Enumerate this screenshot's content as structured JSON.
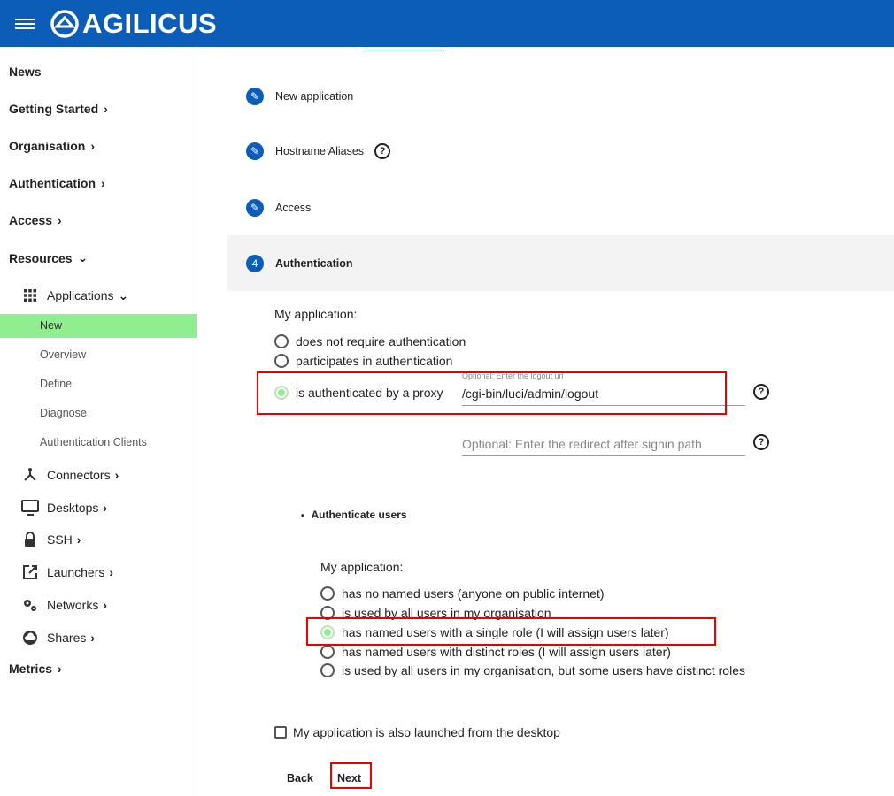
{
  "header": {
    "brand": "AGILICUS"
  },
  "sidebar": {
    "news": "News",
    "getting_started": "Getting Started",
    "organisation": "Organisation",
    "authentication": "Authentication",
    "access": "Access",
    "resources": "Resources",
    "applications": "Applications",
    "app_items": [
      "New",
      "Overview",
      "Define",
      "Diagnose",
      "Authentication Clients"
    ],
    "connectors": "Connectors",
    "desktops": "Desktops",
    "ssh": "SSH",
    "launchers": "Launchers",
    "networks": "Networks",
    "shares": "Shares",
    "metrics": "Metrics"
  },
  "steps": [
    {
      "label": "New application",
      "state": "done"
    },
    {
      "label": "Hostname Aliases",
      "state": "done"
    },
    {
      "label": "Access",
      "state": "done"
    },
    {
      "label": "Authentication",
      "state": "active",
      "number": "4"
    }
  ],
  "auth": {
    "heading": "My application:",
    "options": [
      "does not require authentication",
      "participates in authentication",
      "is authenticated by a proxy"
    ],
    "selected_index": 2,
    "logout_label": "Optional: Enter the logout url",
    "logout_value": "/cgi-bin/luci/admin/logout",
    "redirect_placeholder": "Optional: Enter the redirect after signin path"
  },
  "users": {
    "bullet_title": "Authenticate users",
    "heading": "My application:",
    "options": [
      "has no named users (anyone on public internet)",
      "is used by all users in my organisation",
      "has named users with a single role (I will assign users later)",
      "has named users with distinct roles (I will assign users later)",
      "is used by all users in my organisation, but some users have distinct roles"
    ],
    "selected_index": 2
  },
  "desktop_checkbox": "My application is also launched from the desktop",
  "buttons": {
    "back": "Back",
    "next": "Next"
  },
  "colors": {
    "header": "#0b5db8",
    "active_nav": "#90ee90",
    "highlight": "#e00000"
  }
}
